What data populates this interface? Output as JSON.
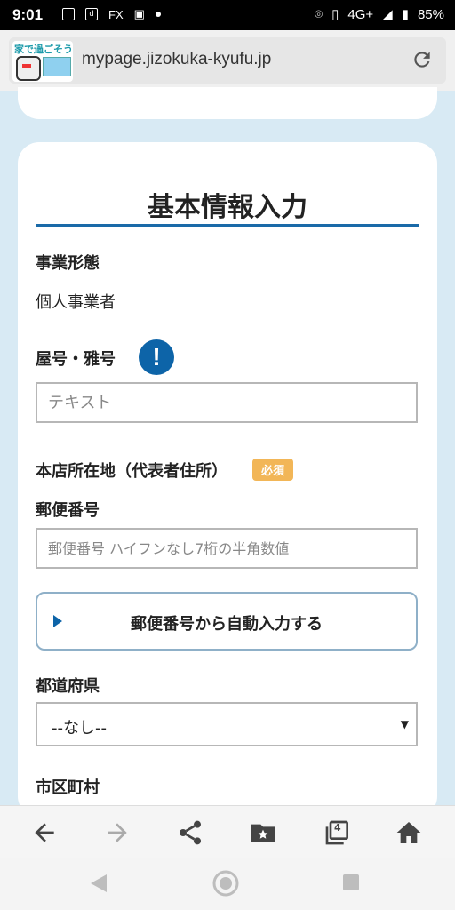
{
  "status": {
    "time": "9:01",
    "network": "4G+",
    "battery": "85%"
  },
  "browser": {
    "favicon_text": "家で過ごそう",
    "url": "mypage.jizokuka-kyufu.jp"
  },
  "form": {
    "title": "基本情報入力",
    "business_type": {
      "label": "事業形態",
      "value": "個人事業者"
    },
    "trade_name": {
      "label": "屋号・雅号",
      "info_icon": "!",
      "placeholder": "テキスト"
    },
    "address": {
      "label": "本店所在地（代表者住所）",
      "badge": "必須"
    },
    "postal": {
      "label": "郵便番号",
      "placeholder": "郵便番号 ハイフンなし7桁の半角数値"
    },
    "auto_fill_button": "郵便番号から自動入力する",
    "prefecture": {
      "label": "都道府県",
      "selected": "--なし--"
    },
    "city": {
      "label": "市区町村"
    }
  },
  "toolbar": {
    "tab_count": "4"
  },
  "colors": {
    "accent": "#0d64a8",
    "badge": "#f2b657",
    "background": "#d8eaf4"
  }
}
